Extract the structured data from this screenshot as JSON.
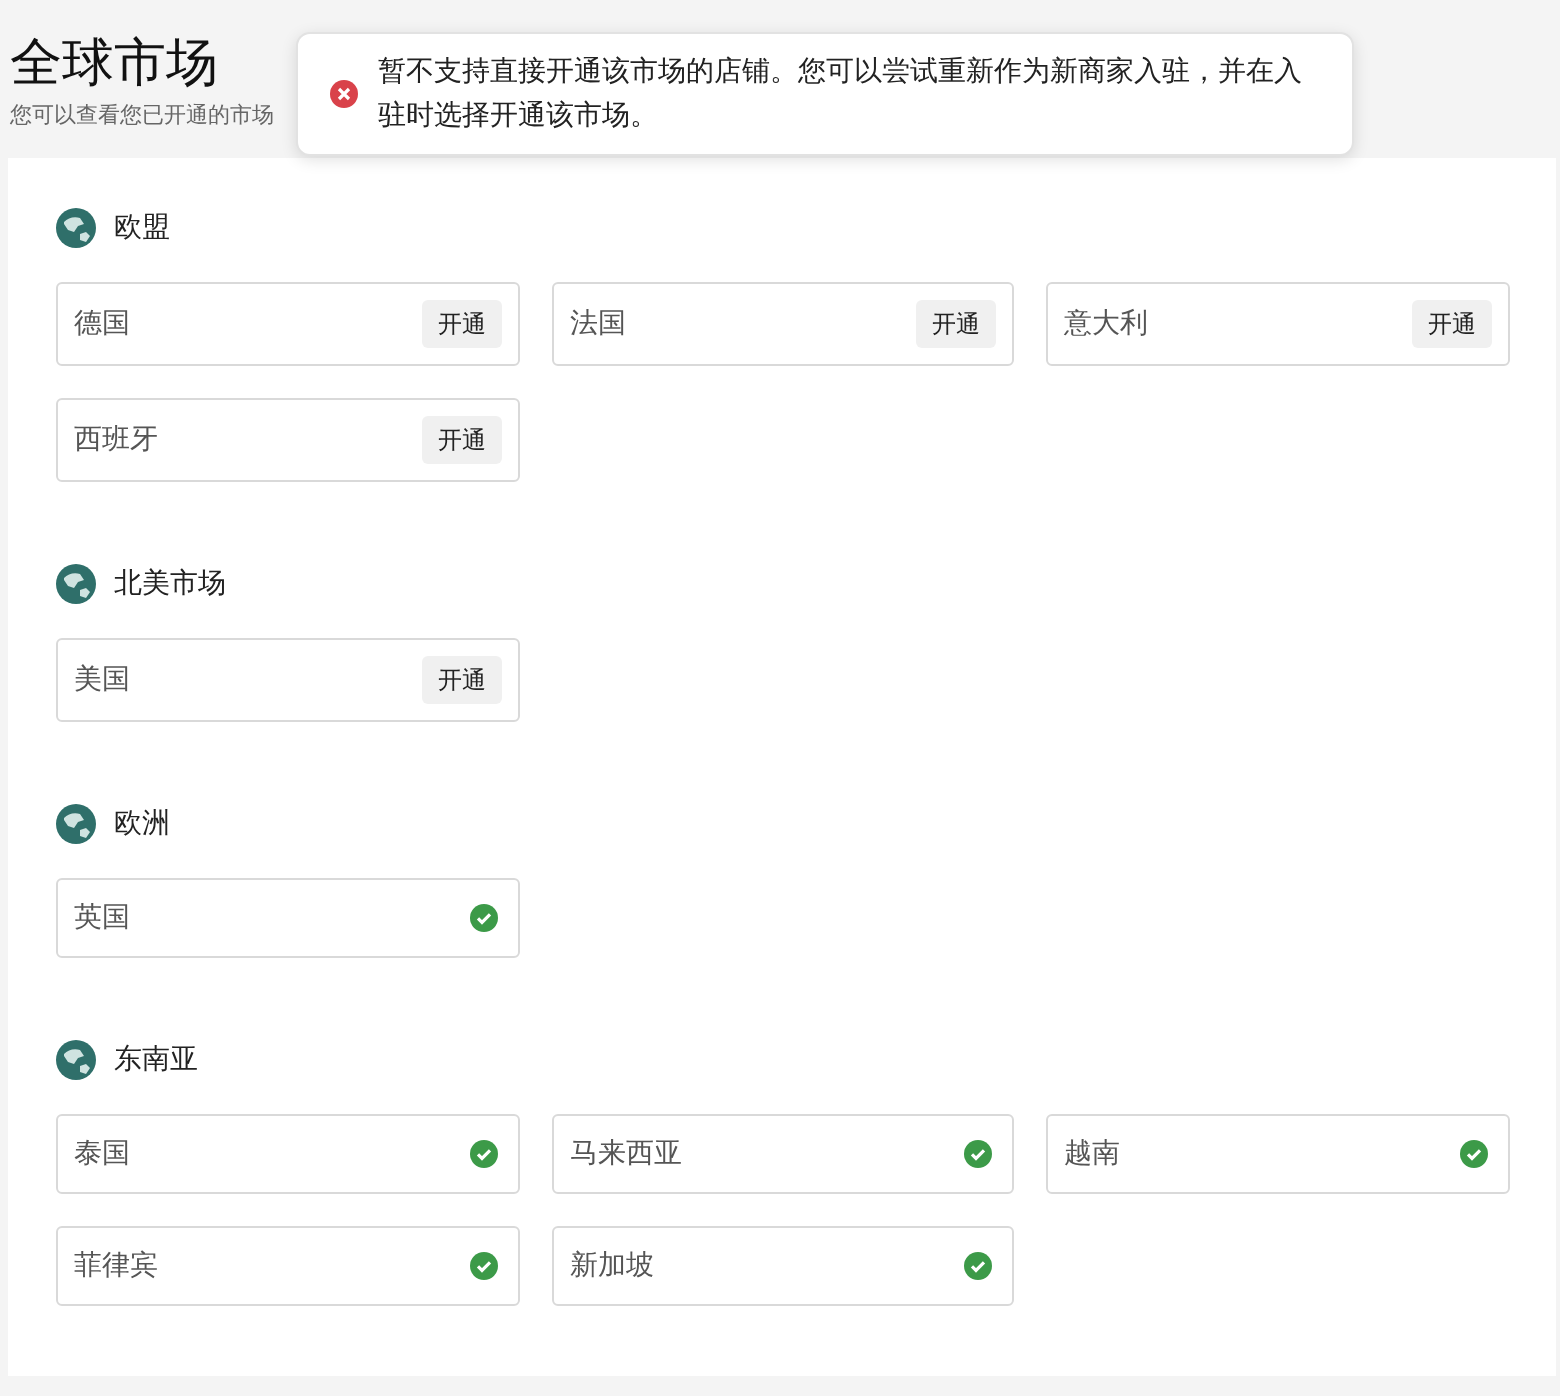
{
  "page": {
    "title": "全球市场",
    "subtitle": "您可以查看您已开通的市场"
  },
  "toast": {
    "kind": "error",
    "message": "暂不支持直接开通该市场的店铺。您可以尝试重新作为新商家入驻，并在入驻时选择开通该市场。"
  },
  "regions": [
    {
      "name": "欧盟",
      "markets": [
        {
          "name": "德国",
          "opened": false,
          "action": "开通"
        },
        {
          "name": "法国",
          "opened": false,
          "action": "开通"
        },
        {
          "name": "意大利",
          "opened": false,
          "action": "开通"
        },
        {
          "name": "西班牙",
          "opened": false,
          "action": "开通"
        }
      ]
    },
    {
      "name": "北美市场",
      "markets": [
        {
          "name": "美国",
          "opened": false,
          "action": "开通"
        }
      ]
    },
    {
      "name": "欧洲",
      "markets": [
        {
          "name": "英国",
          "opened": true
        }
      ]
    },
    {
      "name": "东南亚",
      "markets": [
        {
          "name": "泰国",
          "opened": true
        },
        {
          "name": "马来西亚",
          "opened": true
        },
        {
          "name": "越南",
          "opened": true
        },
        {
          "name": "菲律宾",
          "opened": true
        },
        {
          "name": "新加坡",
          "opened": true
        }
      ]
    }
  ]
}
